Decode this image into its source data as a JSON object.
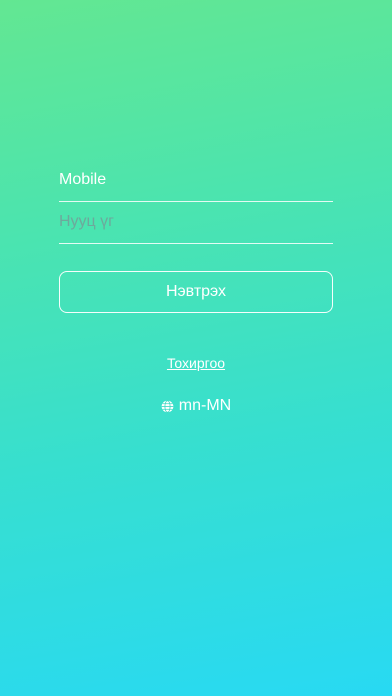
{
  "login": {
    "mobile_placeholder": "Mobile",
    "password_placeholder": "Нууц үг",
    "login_button_label": "Нэвтрэх",
    "settings_link_label": "Тохиргоо",
    "language_label": "mn-MN"
  },
  "icons": {
    "language": "globe-icon"
  },
  "colors": {
    "gradient_top": "#63e792",
    "gradient_bottom": "#28d9f3",
    "text": "#ffffff"
  }
}
